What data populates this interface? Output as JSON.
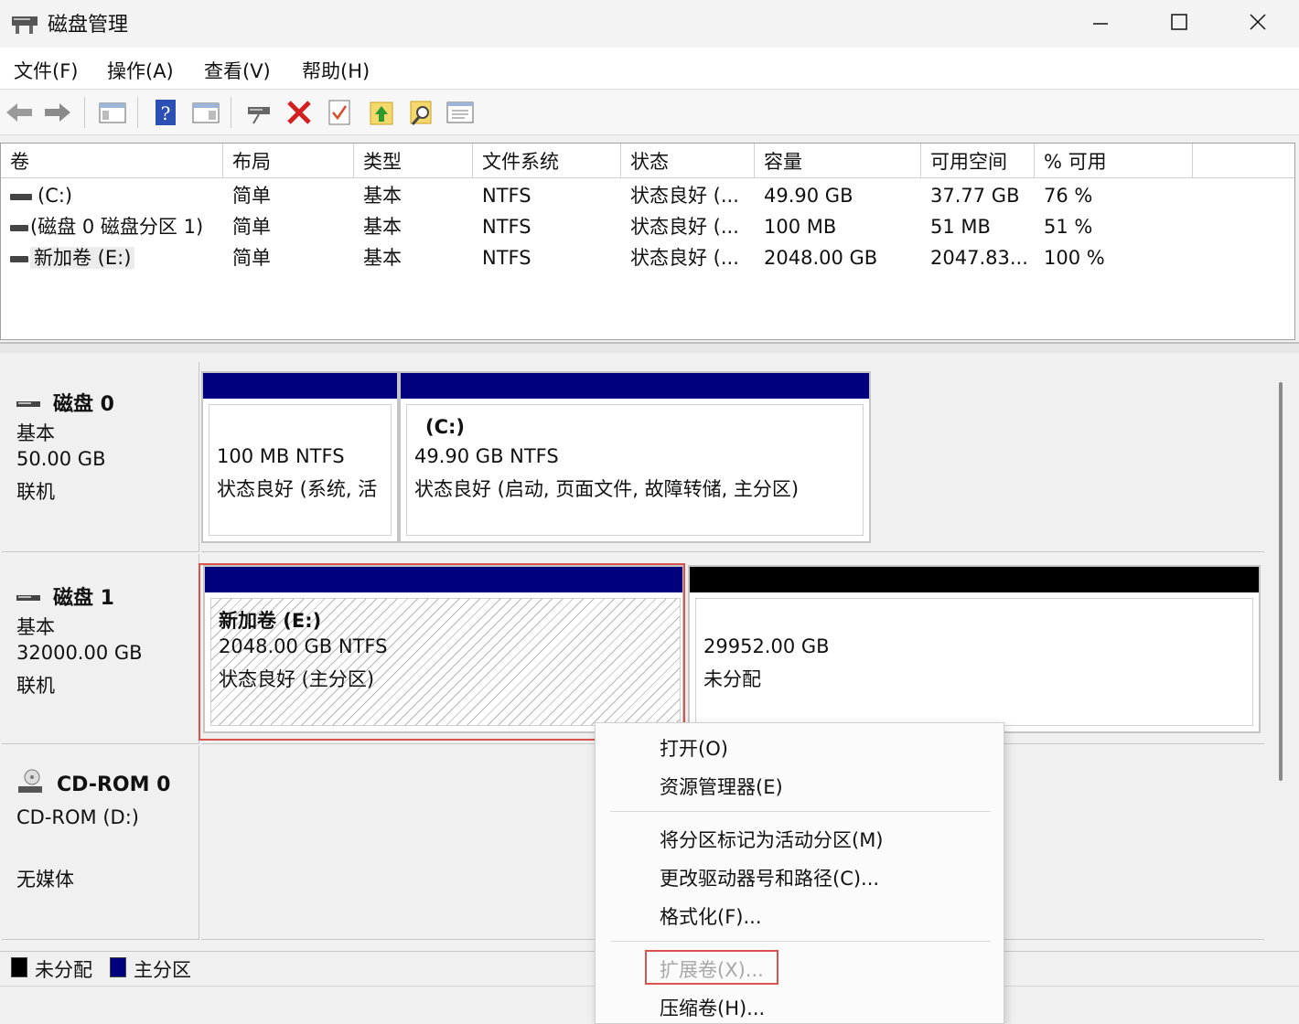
{
  "window": {
    "title": "磁盘管理",
    "minimize_glyph": "—",
    "maximize_glyph": "☐",
    "close_glyph": "✕"
  },
  "menu": [
    "文件(F)",
    "操作(A)",
    "查看(V)",
    "帮助(H)"
  ],
  "toolbar_icons": [
    "back-arrow-icon",
    "forward-arrow-icon",
    "console-tree-icon",
    "help-icon",
    "action-pane-icon",
    "connect-icon",
    "delete-icon",
    "checklist-icon",
    "upload-icon",
    "search-icon",
    "properties-icon"
  ],
  "volume_table": {
    "columns": [
      "卷",
      "布局",
      "类型",
      "文件系统",
      "状态",
      "容量",
      "可用空间",
      "% 可用"
    ],
    "rows": [
      [
        "(C:)",
        "简单",
        "基本",
        "NTFS",
        "状态良好 (...",
        "49.90 GB",
        "37.77 GB",
        "76 %"
      ],
      [
        "(磁盘 0 磁盘分区 1)",
        "简单",
        "基本",
        "NTFS",
        "状态良好 (...",
        "100 MB",
        "51 MB",
        "51 %"
      ],
      [
        "新加卷 (E:)",
        "简单",
        "基本",
        "NTFS",
        "状态良好 (...",
        "2048.00 GB",
        "2047.83...",
        "100 %"
      ]
    ]
  },
  "disks": {
    "disk0": {
      "name": "磁盘 0",
      "type": "基本",
      "size": "50.00 GB",
      "status": "联机",
      "p1": {
        "size_fs": "100 MB NTFS",
        "status": "状态良好 (系统, 活"
      },
      "p2": {
        "label": "(C:)",
        "size_fs": "49.90 GB NTFS",
        "status": "状态良好 (启动, 页面文件, 故障转储, 主分区)"
      }
    },
    "disk1": {
      "name": "磁盘 1",
      "type": "基本",
      "size": "32000.00 GB",
      "status": "联机",
      "p1": {
        "label": "新加卷  (E:)",
        "size_fs": "2048.00 GB NTFS",
        "status": "状态良好 (主分区)"
      },
      "unalloc": {
        "size": "29952.00 GB",
        "label": "未分配"
      }
    },
    "cdrom": {
      "name": "CD-ROM 0",
      "type": "CD-ROM (D:)",
      "media": "无媒体"
    }
  },
  "legend": {
    "unallocated": "未分配",
    "primary": "主分区"
  },
  "colors": {
    "primary": "#00007f",
    "unallocated": "#000000",
    "highlight": "#d9534f"
  },
  "context_menu": {
    "open": "打开(O)",
    "explorer": "资源管理器(E)",
    "mark_active": "将分区标记为活动分区(M)",
    "change_letter": "更改驱动器号和路径(C)...",
    "format": "格式化(F)...",
    "extend": "扩展卷(X)...",
    "shrink": "压缩卷(H)..."
  }
}
